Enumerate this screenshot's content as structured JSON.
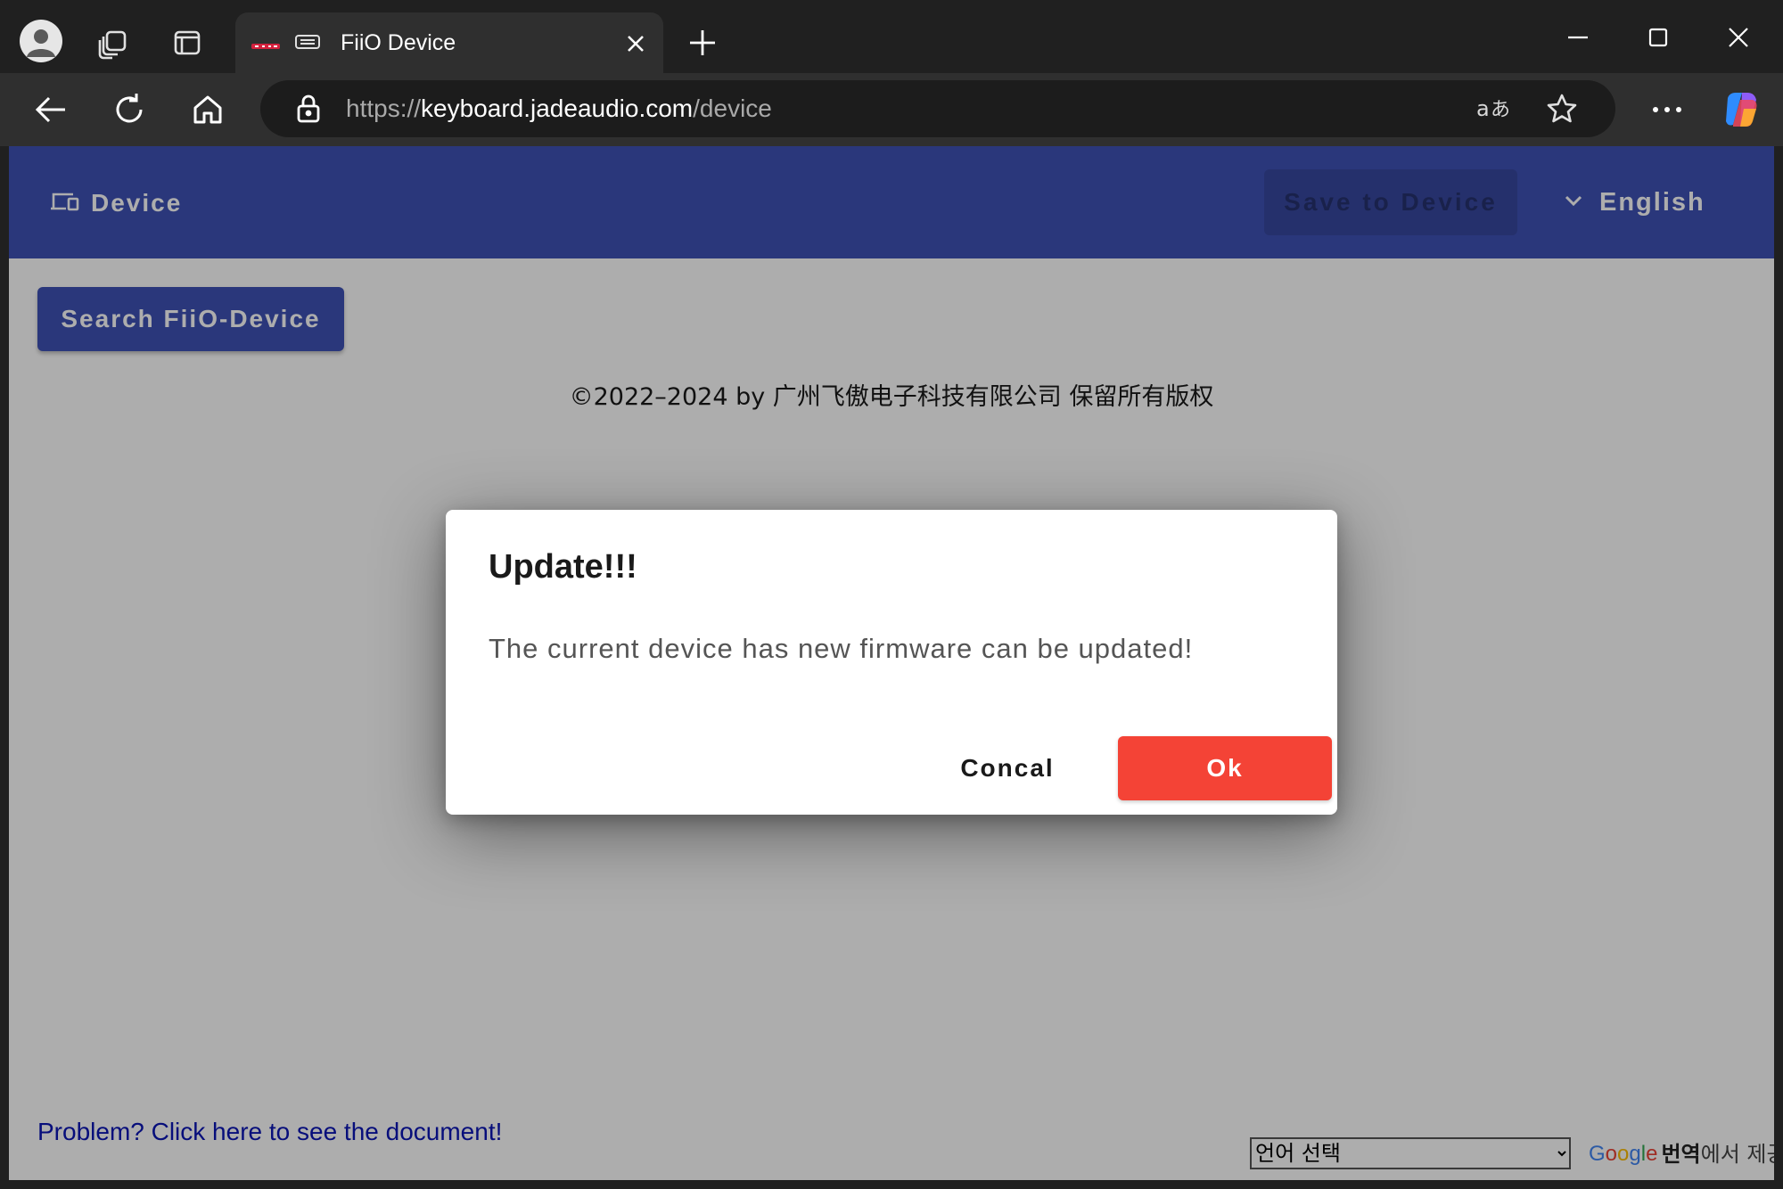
{
  "browser": {
    "tab": {
      "title": "FiiO Device",
      "favicon": "fiio-logo-icon"
    },
    "address_bar": {
      "scheme": "https://",
      "host": "keyboard.jadeaudio.com",
      "path": "/device"
    },
    "icons": [
      "profile-icon",
      "workspaces-icon",
      "tab-actions-icon",
      "close-icon",
      "new-tab-icon",
      "minimize-icon",
      "maximize-icon",
      "back-arrow-icon",
      "reload-icon",
      "home-icon",
      "lock-icon",
      "translate-icon",
      "favorite-star-icon",
      "more-menu-icon",
      "copilot-icon"
    ]
  },
  "app": {
    "header": {
      "device_label": "Device",
      "save_label": "Save to Device",
      "language_label": "English"
    },
    "search_button_label": "Search FiiO-Device",
    "copyright": "©2022–2024 by 广州飞傲电子科技有限公司 保留所有版权",
    "doc_link": "Problem? Click here to see the document!",
    "translate_widget": {
      "select_value": "언어 선택",
      "credit_brand": "Google",
      "credit_word": "번역",
      "credit_suffix": "에서 제공"
    }
  },
  "dialog": {
    "title": "Update!!!",
    "message": "The current device has new firmware can be updated!",
    "cancel_label": "Concal",
    "ok_label": "Ok"
  },
  "colors": {
    "header": "#3f51b5",
    "primary_button": "#3f51b5",
    "ok_button": "#f44336",
    "link": "#0b16b5"
  }
}
